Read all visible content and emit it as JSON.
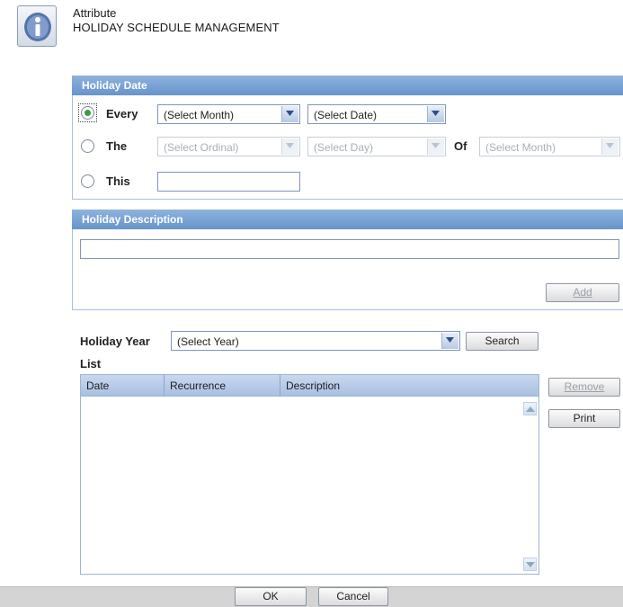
{
  "header": {
    "label": "Attribute",
    "title": "HOLIDAY SCHEDULE MANAGEMENT"
  },
  "holiday_date": {
    "section_title": "Holiday Date",
    "every": {
      "label": "Every",
      "month": "(Select Month)",
      "date": "(Select Date)",
      "selected": true
    },
    "the": {
      "label": "The",
      "ordinal": "(Select Ordinal)",
      "day": "(Select Day)",
      "of_label": "Of",
      "month": "(Select Month)",
      "selected": false
    },
    "this": {
      "label": "This",
      "value": "",
      "selected": false
    }
  },
  "holiday_description": {
    "section_title": "Holiday Description",
    "value": "",
    "add_label": "Add"
  },
  "holiday_year": {
    "label": "Holiday Year",
    "selected": "(Select Year)",
    "search_label": "Search"
  },
  "list": {
    "title": "List",
    "columns": [
      "Date",
      "Recurrence",
      "Description"
    ],
    "rows": [],
    "remove_label": "Remove",
    "print_label": "Print"
  },
  "footer": {
    "ok_label": "OK",
    "cancel_label": "Cancel"
  },
  "colors": {
    "section_header": "#7aa3d6",
    "list_header": "#bccfea",
    "radio_selected": "#3a9a44"
  }
}
